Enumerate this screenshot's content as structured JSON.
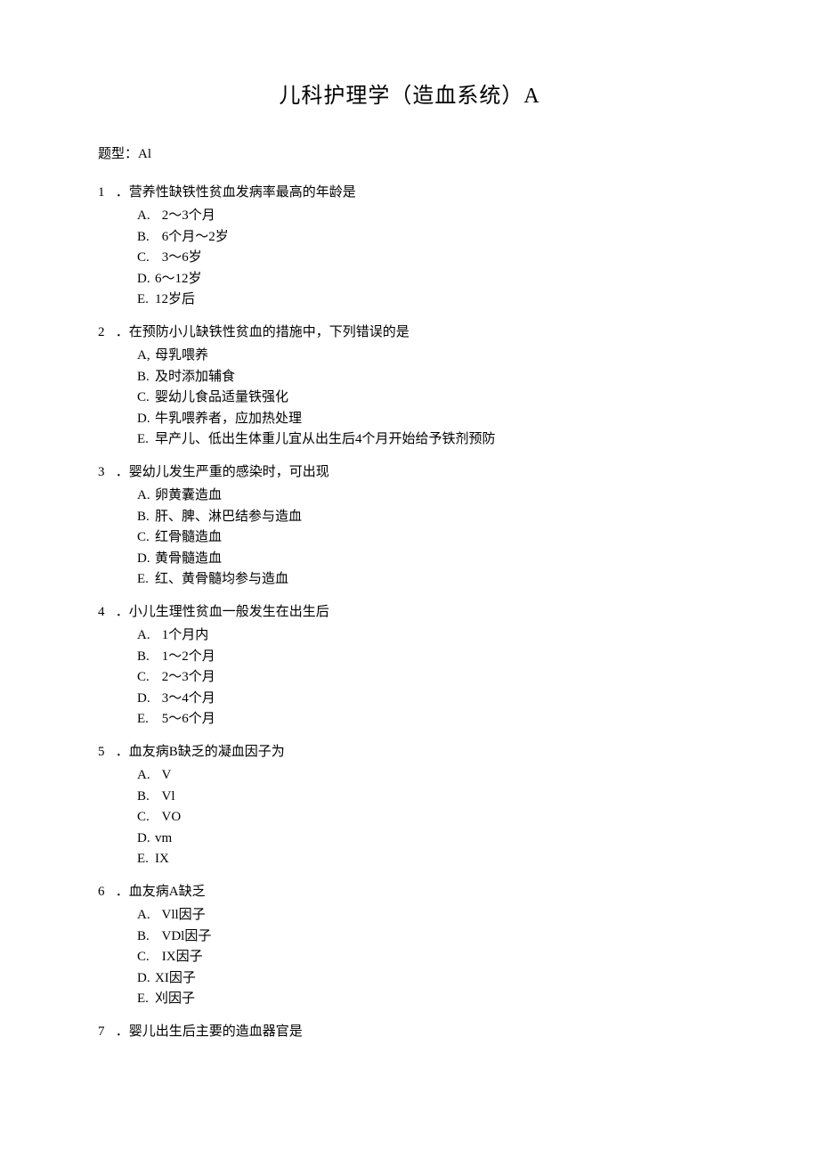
{
  "title": "儿科护理学（造血系统）A",
  "type_label": "题型：Al",
  "questions": [
    {
      "num": "1",
      "stem": "．营养性缺铁性贫血发病率最高的年龄是",
      "options": [
        {
          "letter": "A.",
          "text": "2～3个月",
          "wide": true
        },
        {
          "letter": "B.",
          "text": "6个月～2岁",
          "wide": true
        },
        {
          "letter": "C.",
          "text": "3～6岁",
          "wide": true
        },
        {
          "letter": "D.",
          "text": "6～12岁"
        },
        {
          "letter": "E.",
          "text": "12岁后"
        }
      ]
    },
    {
      "num": "2",
      "stem": "．在预防小儿缺铁性贫血的措施中，下列错误的是",
      "options": [
        {
          "letter": "A,",
          "text": "母乳喂养"
        },
        {
          "letter": "B.",
          "text": "及时添加辅食"
        },
        {
          "letter": "C.",
          "text": "婴幼儿食品适量铁强化"
        },
        {
          "letter": "D.",
          "text": "牛乳喂养者，应加热处理"
        },
        {
          "letter": "E.",
          "text": "早产儿、低出生体重儿宜从出生后4个月开始给予铁剂预防"
        }
      ]
    },
    {
      "num": "3",
      "stem": "．婴幼儿发生严重的感染时，可出现",
      "options": [
        {
          "letter": "A.",
          "text": "卵黄囊造血"
        },
        {
          "letter": "B.",
          "text": "肝、脾、淋巴结参与造血"
        },
        {
          "letter": "C.",
          "text": "红骨髓造血"
        },
        {
          "letter": "D.",
          "text": "黄骨髓造血"
        },
        {
          "letter": "E.",
          "text": "红、黄骨髓均参与造血"
        }
      ]
    },
    {
      "num": "4",
      "stem": "．小儿生理性贫血一般发生在出生后",
      "options": [
        {
          "letter": "A.",
          "text": "1个月内",
          "wide": true
        },
        {
          "letter": "B.",
          "text": "1～2个月",
          "wide": true
        },
        {
          "letter": "C.",
          "text": "2～3个月",
          "wide": true
        },
        {
          "letter": "D.",
          "text": "3～4个月",
          "wide": true
        },
        {
          "letter": "E.",
          "text": "5～6个月",
          "wide": true
        }
      ]
    },
    {
      "num": "5",
      "stem": "．血友病B缺乏的凝血因子为",
      "options": [
        {
          "letter": "A.",
          "text": "V",
          "wide": true
        },
        {
          "letter": "B.",
          "text": "Vl",
          "wide": true
        },
        {
          "letter": "C.",
          "text": "VO",
          "wide": true
        },
        {
          "letter": "D.",
          "text": "vm"
        },
        {
          "letter": "E.",
          "text": "IX"
        }
      ]
    },
    {
      "num": "6",
      "stem": "．血友病A缺乏",
      "options": [
        {
          "letter": "A.",
          "text": "Vll因子",
          "wide": true
        },
        {
          "letter": "B.",
          "text": "VDl因子",
          "wide": true
        },
        {
          "letter": "C.",
          "text": "IX因子",
          "wide": true
        },
        {
          "letter": "D.",
          "text": "XI因子"
        },
        {
          "letter": "E.",
          "text": "刈因子"
        }
      ]
    },
    {
      "num": "7",
      "stem": "．婴儿出生后主要的造血器官是",
      "options": []
    }
  ]
}
